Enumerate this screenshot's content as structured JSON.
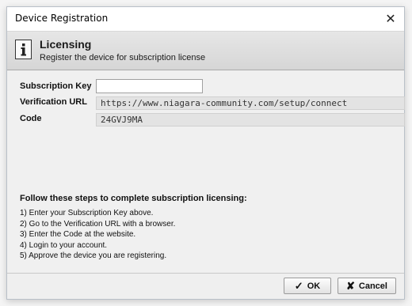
{
  "window": {
    "title": "Device Registration",
    "close_glyph": "✕"
  },
  "banner": {
    "icon": "info-icon",
    "title": "Licensing",
    "subtitle": "Register the device for subscription license"
  },
  "form": {
    "subscription_key": {
      "label": "Subscription Key",
      "value": "",
      "placeholder": ""
    },
    "verification_url": {
      "label": "Verification URL",
      "value": "https://www.niagara-community.com/setup/connect"
    },
    "code": {
      "label": "Code",
      "value": "24GVJ9MA"
    }
  },
  "steps": {
    "heading": "Follow these steps to complete subscription licensing:",
    "items": [
      "1) Enter your Subscription Key above.",
      "2) Go to the Verification URL with a browser.",
      "3) Enter the Code at the website.",
      "4) Login to your account.",
      "5) Approve the device you are registering."
    ]
  },
  "buttons": {
    "ok": {
      "label": "OK",
      "icon": "checkmark-icon",
      "glyph": "✓",
      "color": "#333333"
    },
    "cancel": {
      "label": "Cancel",
      "icon": "x-icon",
      "glyph": "✘",
      "color": "#333333"
    }
  }
}
